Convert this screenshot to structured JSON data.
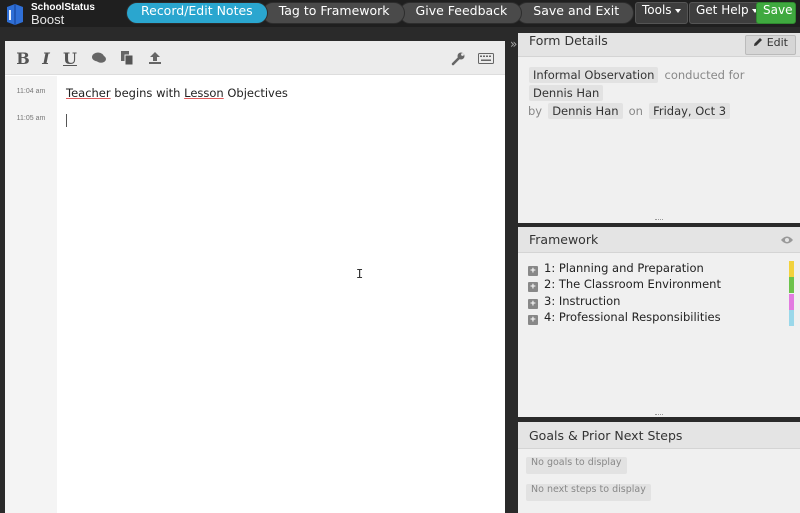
{
  "logo": {
    "top": "SchoolStatus",
    "bottom": "Boost"
  },
  "steps": [
    {
      "label": "Record/Edit Notes"
    },
    {
      "label": "Tag to Framework"
    },
    {
      "label": "Give Feedback"
    },
    {
      "label": "Save and Exit"
    }
  ],
  "topbar": {
    "tools": "Tools",
    "help": "Get Help",
    "save": "Save"
  },
  "editor": {
    "toolbar": {
      "bold": "B",
      "italic": "I",
      "underline": "U"
    },
    "entries": [
      {
        "time": "11:04 am",
        "w1": "Teacher",
        "w2": " begins with ",
        "w3": "Lesson",
        "w4": " Objectives"
      },
      {
        "time": "11:05 am"
      }
    ]
  },
  "form_details": {
    "title": "Form Details",
    "edit": "Edit",
    "type": "Informal Observation",
    "conducted_for_label": "conducted for",
    "subject": "Dennis Han",
    "by_label": "by",
    "observer": "Dennis Han",
    "on_label": "on",
    "date": "Friday, Oct 3"
  },
  "framework": {
    "title": "Framework",
    "items": [
      {
        "label": "1: Planning and Preparation",
        "color": "#f2d23c"
      },
      {
        "label": "2: The Classroom Environment",
        "color": "#6cc24a"
      },
      {
        "label": "3: Instruction",
        "color": "#e27be0"
      },
      {
        "label": "4: Professional Responsibilities",
        "color": "#9ad8ea"
      }
    ]
  },
  "goals": {
    "title": "Goals & Prior Next Steps",
    "no_goals": "No goals to display",
    "no_steps": "No next steps to display"
  }
}
